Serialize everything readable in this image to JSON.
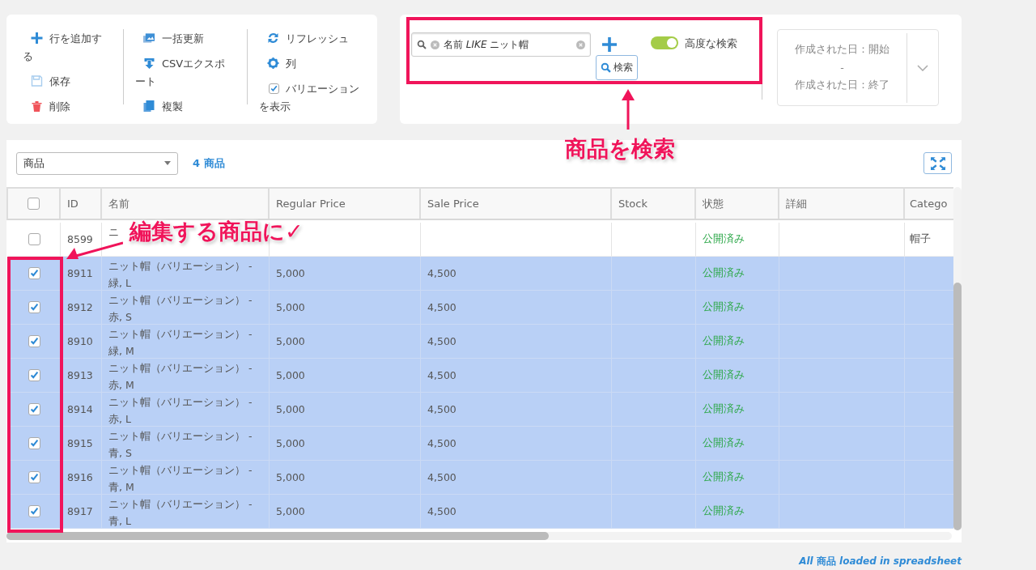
{
  "toolbar": {
    "groups": [
      {
        "items": [
          {
            "kind": "button",
            "label": "行を追加する"
          },
          {
            "kind": "button",
            "label": "保存"
          },
          {
            "kind": "button",
            "label": "削除"
          }
        ]
      },
      {
        "items": [
          {
            "kind": "button",
            "label": "一括更新"
          },
          {
            "kind": "button",
            "label": "CSVエクスポート"
          },
          {
            "kind": "button",
            "label": "複製"
          }
        ]
      },
      {
        "items": [
          {
            "kind": "button",
            "label": "リフレッシュ"
          },
          {
            "kind": "button",
            "label": "列"
          },
          {
            "kind": "checkbox",
            "checked": true,
            "label": "バリエーションを表示"
          }
        ]
      }
    ]
  },
  "search": {
    "filter": "名前 *LIKE* ニット帽",
    "search_button": "検索",
    "advanced": {
      "label": "高度な検索",
      "on": true
    },
    "date_from": "作成された日：開始",
    "date_sep": "-",
    "date_to": "作成された日：終了"
  },
  "list_header": {
    "post_type": "商品",
    "count": "4 商品"
  },
  "table": {
    "all_selected": false,
    "columns": [
      "ID",
      "名前",
      "Regular Price",
      "Sale Price",
      "Stock",
      "状態",
      "詳細",
      "Catego"
    ],
    "rows": [
      {
        "selected": false,
        "id": "8599",
        "name": "ニ",
        "status": "公開済み",
        "category": "帽子"
      },
      {
        "selected": true,
        "id": "8911",
        "name": "ニット帽（バリエーション） - 緑, L",
        "regular": "5,000",
        "sale": "4,500",
        "status": "公開済み"
      },
      {
        "selected": true,
        "id": "8912",
        "name": "ニット帽（バリエーション） - 赤, S",
        "regular": "5,000",
        "sale": "4,500",
        "status": "公開済み"
      },
      {
        "selected": true,
        "id": "8910",
        "name": "ニット帽（バリエーション） - 緑, M",
        "regular": "5,000",
        "sale": "4,500",
        "status": "公開済み"
      },
      {
        "selected": true,
        "id": "8913",
        "name": "ニット帽（バリエーション） - 赤, M",
        "regular": "5,000",
        "sale": "4,500",
        "status": "公開済み"
      },
      {
        "selected": true,
        "id": "8914",
        "name": "ニット帽（バリエーション） - 赤, L",
        "regular": "5,000",
        "sale": "4,500",
        "status": "公開済み"
      },
      {
        "selected": true,
        "id": "8915",
        "name": "ニット帽（バリエーション） - 青, S",
        "regular": "5,000",
        "sale": "4,500",
        "status": "公開済み"
      },
      {
        "selected": true,
        "id": "8916",
        "name": "ニット帽（バリエーション） - 青, M",
        "regular": "5,000",
        "sale": "4,500",
        "status": "公開済み"
      },
      {
        "selected": true,
        "id": "8917",
        "name": "ニット帽（バリエーション） - 青, L",
        "regular": "5,000",
        "sale": "4,500",
        "status": "公開済み"
      }
    ]
  },
  "footer": "*All* 商品 *loaded in spreadsheet*",
  "annotations": [
    {
      "kind": "search",
      "text": "商品を検索"
    },
    {
      "kind": "checkboxes",
      "text": "編集する商品に✓"
    }
  ]
}
